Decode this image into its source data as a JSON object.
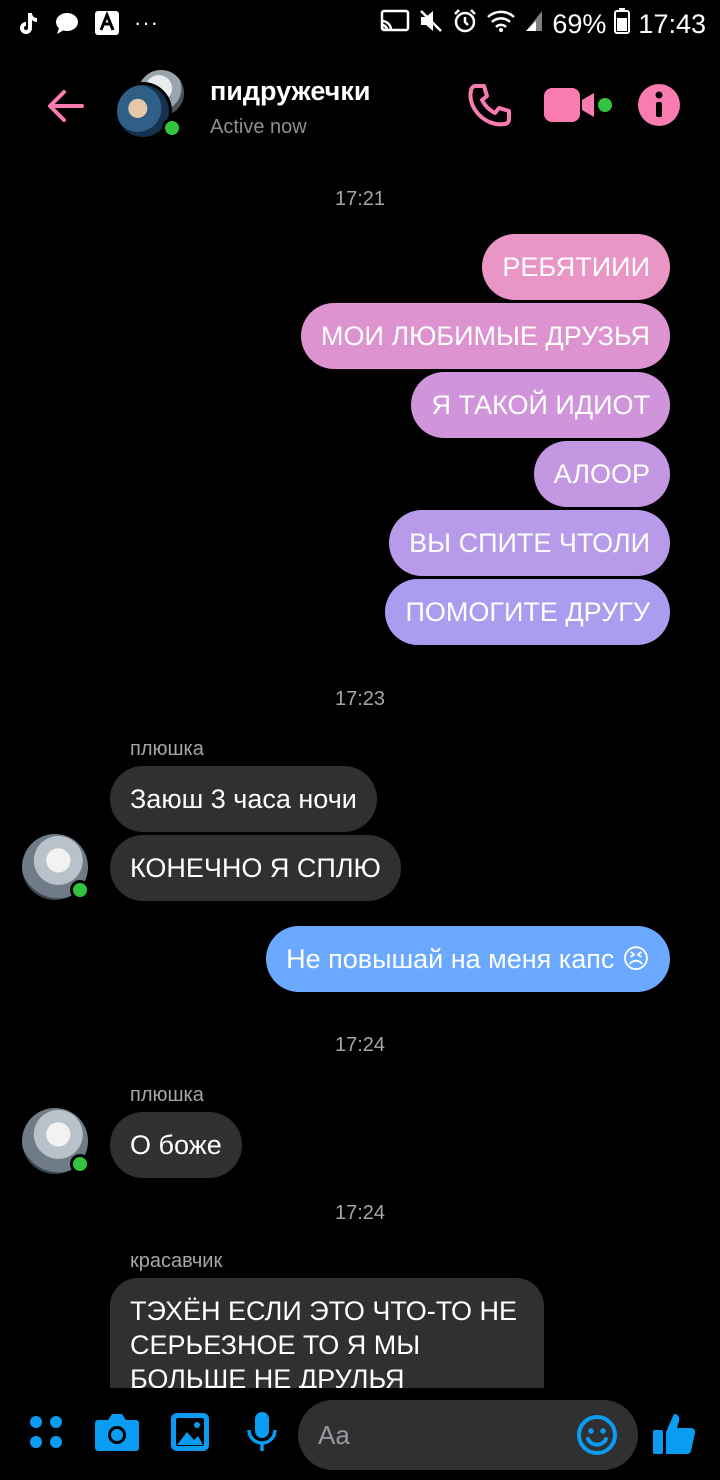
{
  "status_bar": {
    "battery": "69%",
    "time": "17:43",
    "dots": "···"
  },
  "header": {
    "title": "пидружечки",
    "status": "Active now",
    "accent_color": "#fa7bb0"
  },
  "thread": {
    "timestamps": [
      "17:21",
      "17:23",
      "17:24",
      "17:24"
    ],
    "outgoing_block": [
      "РЕБЯТИИИ",
      "МОИ ЛЮБИМЫЕ ДРУЗЬЯ",
      "Я ТАКОЙ ИДИОТ",
      "АЛООР",
      "ВЫ СПИТЕ ЧТОЛИ",
      "ПОМОГИТЕ ДРУГУ"
    ],
    "group1": {
      "sender": "плюшка",
      "messages": [
        "Заюш 3 часа ночи",
        "КОНЕЧНО Я СПЛЮ"
      ]
    },
    "outgoing_reply": "Не повышай на меня капс 😣",
    "group2": {
      "sender": "плюшка",
      "messages": [
        "О боже"
      ]
    },
    "group3": {
      "sender": "красавчик",
      "message": "ТЭХЁН ЕСЛИ ЭТО ЧТО-ТО НЕ СЕРЬЕЗНОЕ ТО Я МЫ БОЛЬШЕ НЕ ДРУЛЬЯ"
    }
  },
  "composer": {
    "placeholder": "Aa",
    "icon_color": "#0a9cf2"
  }
}
